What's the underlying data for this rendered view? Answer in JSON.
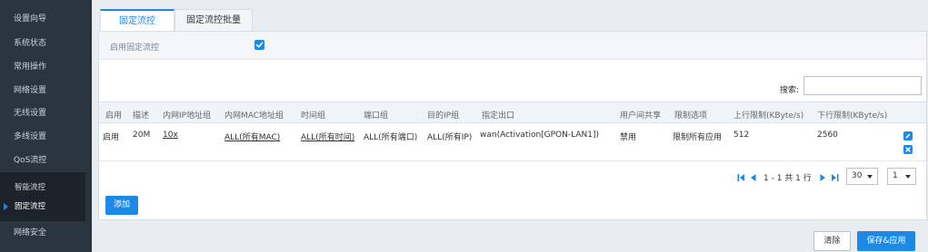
{
  "sidebar": {
    "items": [
      {
        "label": "设置向导"
      },
      {
        "label": "系统状态"
      },
      {
        "label": "常用操作"
      },
      {
        "label": "网络设置"
      },
      {
        "label": "无线设置"
      },
      {
        "label": "多线设置"
      },
      {
        "label": "QoS流控"
      },
      {
        "label": "网络安全"
      }
    ],
    "sub_items": [
      {
        "label": "智能流控"
      },
      {
        "label": "固定流控"
      }
    ],
    "active_sub": "固定流控"
  },
  "tabs": [
    {
      "label": "固定流控",
      "active": true
    },
    {
      "label": "固定流控批量",
      "active": false
    }
  ],
  "enable": {
    "label": "启用固定流控",
    "checked": true
  },
  "search": {
    "label": "搜索:",
    "value": ""
  },
  "table": {
    "headers": [
      "启用",
      "描述",
      "内网IP地址组",
      "内网MAC地址组",
      "时间组",
      "端口组",
      "目的IP组",
      "指定出口",
      "用户间共享",
      "限制选项",
      "上行限制(KByte/s)",
      "下行限制(KByte/s)"
    ],
    "rows": [
      {
        "enabled": "启用",
        "desc": "20M",
        "ip_group": "10x",
        "mac_group": "ALL(所有MAC)",
        "time_group": "ALL(所有时间)",
        "port_group": "ALL(所有端口)",
        "dest_ip_group": "ALL(所有IP)",
        "outlet": "wan(Activation[GPON-LAN1])",
        "share": "禁用",
        "limit_option": "限制所有应用",
        "up_limit": "512",
        "down_limit": "2560"
      }
    ]
  },
  "pagination": {
    "info": "1 - 1 共 1 行",
    "page_size": "30",
    "page": "1"
  },
  "buttons": {
    "add": "添加",
    "clear": "清除",
    "save": "保存&应用"
  },
  "colors": {
    "accent": "#1e88e5",
    "sidebar_bg": "#2b3540",
    "header_bg": "#eef4f9"
  }
}
